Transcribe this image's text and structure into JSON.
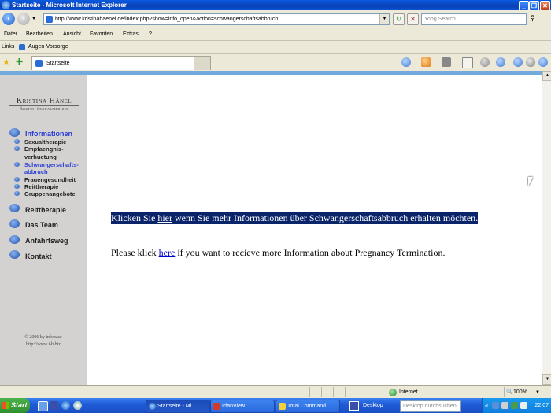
{
  "window": {
    "title": "Startseite - Microsoft Internet Explorer",
    "minimize": "_",
    "maximize": "❐",
    "close": "✕"
  },
  "address": {
    "url": "http://www.kristinahaenel.de/index.php?show=info_open&action=schwangerschaftsabbruch",
    "search_placeholder": "Yoog Search"
  },
  "menu": [
    "Datei",
    "Bearbeiten",
    "Ansicht",
    "Favoriten",
    "Extras",
    "?"
  ],
  "links_bar": {
    "label": "Links",
    "item": "Augen-Vorsorge"
  },
  "tab": {
    "label": "Startseite"
  },
  "logo": {
    "name": "Kristina Hänel",
    "subtitle": "Ärztin. Sexualmedizin"
  },
  "nav": {
    "informationen": "Informationen",
    "sub": [
      "Sexualtherapie",
      "Empfaengnis-",
      "verhuetung",
      "Schwangerschafts-",
      "abbruch",
      "Frauengesundheit",
      "Reittherapie",
      "Gruppenangebote"
    ],
    "reittherapie": "Reittherapie",
    "das_team": "Das Team",
    "anfahrtsweg": "Anfahrtsweg",
    "kontakt": "Kontakt"
  },
  "copyright": {
    "line1": "© 2006 by infobase",
    "line2": "http://www.i-b.biz"
  },
  "content": {
    "de_before": "Klicken Sie ",
    "de_link": "hier",
    "de_after": " wenn Sie mehr Informationen über Schwangerschaftsabbruch erhalten möchten.",
    "en_before": "Please klick ",
    "en_link": "here",
    "en_after": " if you want to recieve more Information about Pregnancy Termination."
  },
  "status": {
    "zone": "Internet",
    "zoom": "100%"
  },
  "taskbar": {
    "start": "Start",
    "items": [
      "Startseite - Mi...",
      "IrfanView",
      "Total Command...",
      "Desktop"
    ],
    "desk_search": "Desktop durchsuchen",
    "clock": "22:07"
  },
  "colors": {
    "accent_blue": "#2a3dd6",
    "selection": "#0a246a",
    "sidebar": "#d4d2d0",
    "topstrip": "#74a9dd"
  }
}
